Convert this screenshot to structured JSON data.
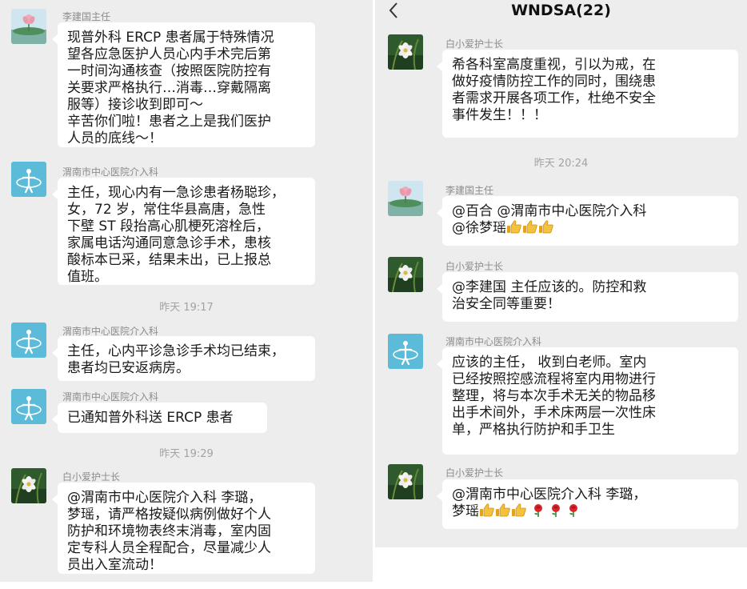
{
  "senders": {
    "li": "李建国主任",
    "weinan": "渭南市中心医院介入科",
    "bai": "白小爱护士长"
  },
  "left": {
    "messages": [
      {
        "lines": [
          "现普外科 ERCP 患者属于特殊情况",
          "望各应急医护人员心内手术完后第",
          "一时间沟通核查（按照医院防控有",
          "关要求严格执行…消毒…穿戴隔离",
          "服等）接诊收到即可～",
          "辛苦你们啦！患者之上是我们医护",
          "人员的底线～！"
        ]
      },
      {
        "lines": [
          "主任，现心内有一急诊患者杨聪珍，",
          "女，72 岁，常住华县高唐，急性",
          "下壁 ST 段抬高心肌梗死溶栓后，",
          "家属电话沟通同意急诊手术，患核",
          "酸标本已采，结果未出，已上报总",
          "值班。"
        ]
      },
      {
        "lines": [
          "主任，心内平诊急诊手术均已结束，",
          "患者均已安返病房。"
        ]
      },
      {
        "lines": [
          "已通知普外科送 ERCP 患者"
        ]
      },
      {
        "lines": [
          "@渭南市中心医院介入科  李璐，",
          "梦瑶，请严格按疑似病例做好个人",
          "防护和环境物表终末消毒，室内固",
          "定专科人员全程配合，尽量减少人",
          "员出入室流动！"
        ]
      }
    ],
    "times": [
      "昨天 19:17",
      "昨天 19:29"
    ]
  },
  "right": {
    "header": {
      "title": "WNDSA(22)",
      "back_icon": "chevron-left-icon"
    },
    "messages": [
      {
        "lines": [
          "希各科室高度重视，引以为戒，在",
          "做好疫情防控工作的同时，围绕患",
          "者需求开展各项工作，杜绝不安全",
          "事件发生！！！"
        ]
      },
      {
        "lines": [
          "@百合  @渭南市中心医院介入科",
          "@徐梦瑶"
        ],
        "emoji": "thumbs-up-icon x3"
      },
      {
        "lines": [
          "@李建国  主任应该的。防控和救",
          "治安全同等重要！"
        ]
      },
      {
        "lines": [
          "应该的主任，  收到白老师。室内",
          "已经按照控感流程将室内用物进行",
          "整理，将与本次手术无关的物品移",
          "出手术间外，手术床两层一次性床",
          "单，严格执行防护和手卫生"
        ]
      },
      {
        "lines": [
          "@渭南市中心医院介入科  李璐，",
          "梦瑶"
        ],
        "emoji": "thumbs-up-icon x3, rose-icon x3"
      }
    ],
    "times": [
      "昨天 20:24"
    ]
  }
}
